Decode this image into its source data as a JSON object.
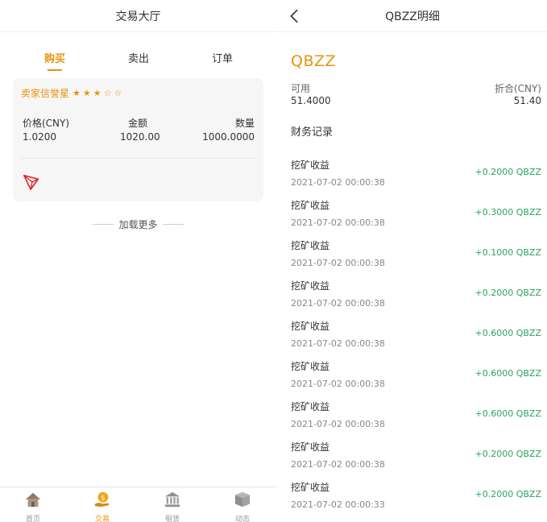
{
  "left": {
    "title": "交易大厅",
    "tabs": [
      {
        "label": "购买",
        "active": true
      },
      {
        "label": "卖出",
        "active": false
      },
      {
        "label": "订单",
        "active": false
      }
    ],
    "card": {
      "seller_label": "卖家信誉星",
      "rating": 3,
      "rating_max": 5,
      "price_label": "价格(CNY)",
      "price_value": "1.0200",
      "amount_label": "金额",
      "amount_value": "1020.00",
      "qty_label": "数量",
      "qty_value": "1000.0000",
      "coin_icon": "tron-icon"
    },
    "load_more": "加载更多",
    "tabbar": [
      {
        "label": "首页",
        "icon": "home-icon",
        "active": false
      },
      {
        "label": "交易",
        "icon": "money-hand-icon",
        "active": true
      },
      {
        "label": "租赁",
        "icon": "bank-icon",
        "active": false
      },
      {
        "label": "动态",
        "icon": "box-icon",
        "active": false
      }
    ]
  },
  "right": {
    "title": "QBZZ明细",
    "coin": "QBZZ",
    "available_label": "可用",
    "available_value": "51.4000",
    "converted_label": "折合(CNY)",
    "converted_value": "51.40",
    "records_title": "财务记录",
    "records": [
      {
        "type": "挖矿收益",
        "time": "2021-07-02 00:00:38",
        "amount": "+0.2000 QBZZ"
      },
      {
        "type": "挖矿收益",
        "time": "2021-07-02 00:00:38",
        "amount": "+0.3000 QBZZ"
      },
      {
        "type": "挖矿收益",
        "time": "2021-07-02 00:00:38",
        "amount": "+0.1000 QBZZ"
      },
      {
        "type": "挖矿收益",
        "time": "2021-07-02 00:00:38",
        "amount": "+0.2000 QBZZ"
      },
      {
        "type": "挖矿收益",
        "time": "2021-07-02 00:00:38",
        "amount": "+0.6000 QBZZ"
      },
      {
        "type": "挖矿收益",
        "time": "2021-07-02 00:00:38",
        "amount": "+0.6000 QBZZ"
      },
      {
        "type": "挖矿收益",
        "time": "2021-07-02 00:00:38",
        "amount": "+0.6000 QBZZ"
      },
      {
        "type": "挖矿收益",
        "time": "2021-07-02 00:00:38",
        "amount": "+0.2000 QBZZ"
      },
      {
        "type": "挖矿收益",
        "time": "2021-07-02 00:00:33",
        "amount": "+0.2000 QBZZ"
      }
    ]
  },
  "colors": {
    "accent": "#e8930c",
    "positive": "#2aa55a",
    "tron": "#e0262b"
  }
}
